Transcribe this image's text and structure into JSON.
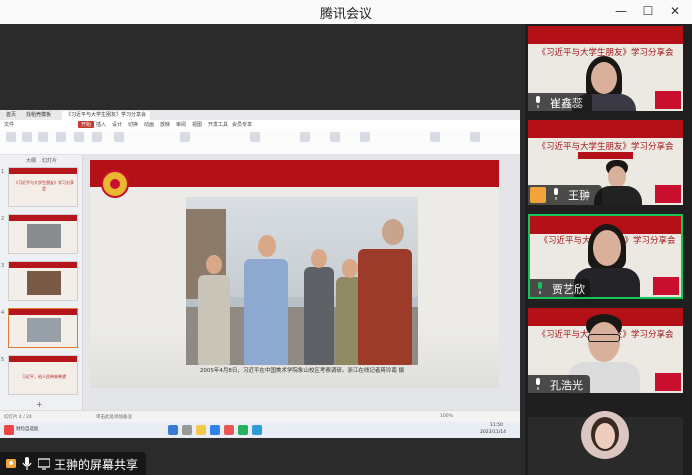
{
  "window": {
    "title": "腾讯会议",
    "controls": [
      "—",
      "☐",
      "✕"
    ]
  },
  "shared_screen": {
    "wps": {
      "tabs": [
        "首页",
        "找稻壳模板",
        "《习近平与大学生朋友》学习分享会"
      ],
      "menu": [
        "文件",
        "开始",
        "插入",
        "设计",
        "切换",
        "动画",
        "放映",
        "审阅",
        "视图",
        "开发工具",
        "会员专享"
      ],
      "pane_tabs": [
        "大纲",
        "幻灯片"
      ],
      "slides": [
        {
          "num": "1",
          "title": "《习近平与大学生朋友》学习分享会"
        },
        {
          "num": "2",
          "title": ""
        },
        {
          "num": "3",
          "title": ""
        },
        {
          "num": "4",
          "title": ""
        },
        {
          "num": "5",
          "title": "习近平，给人民带来希望"
        }
      ],
      "slide_caption": "2005年4月8日，习近平在中国美术学院象山校区考察调研。浙江在线记者蒋玲南 摄",
      "status_left": "幻灯片 4 / 24",
      "status_note": "单击此处添加备注",
      "zoom": "100%",
      "taskbar_left": "财险自选股",
      "taskbar_time": "11:50",
      "taskbar_date": "2023/11/14"
    },
    "share_label": "王翀的屏幕共享"
  },
  "participants": [
    {
      "name": "崔鑫蕊",
      "slide_title": "《习近平与大学生朋友》学习分享会"
    },
    {
      "name": "王翀",
      "slide_title": "《习近平与大学生朋友》学习分享会"
    },
    {
      "name": "贾艺欣",
      "slide_title": "《习近平与大学生朋友》学习分享会",
      "speaking": true
    },
    {
      "name": "孔浩光",
      "slide_title": "《习近平与大学生朋友》学习分享会"
    },
    {
      "name": "",
      "slide_title": ""
    }
  ],
  "colors": {
    "accent_red": "#b31117",
    "active_speaker": "#18c45a"
  }
}
